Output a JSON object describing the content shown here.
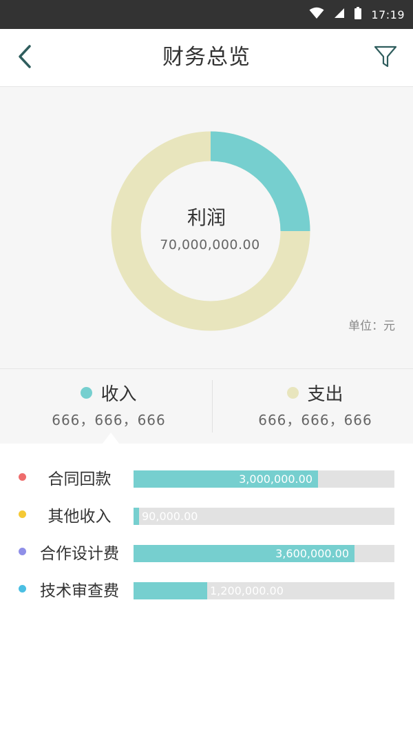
{
  "status_bar": {
    "time": "17:19",
    "icons": [
      "wifi-icon",
      "signal-icon",
      "battery-icon"
    ]
  },
  "header": {
    "title": "财务总览",
    "back_icon": "chevron-left-icon",
    "filter_icon": "filter-icon"
  },
  "donut": {
    "center_label": "利润",
    "center_value": "70,000,000.00",
    "unit": "单位：元",
    "share_income": 0.25,
    "income_color": "#76cfcf",
    "expense_color": "#e8e5bd"
  },
  "summary": {
    "income": {
      "label": "收入",
      "amount": "666，666，666",
      "color": "#76cfcf"
    },
    "expense": {
      "label": "支出",
      "amount": "666，666，666",
      "color": "#e8e5bd"
    }
  },
  "breakdown": {
    "max_value": 4250000,
    "items": [
      {
        "label": "合同回款",
        "value": 3000000,
        "value_label": "3,000,000.00",
        "bullet_color": "#ee6c6c"
      },
      {
        "label": "其他收入",
        "value": 90000,
        "value_label": "90,000.00",
        "bullet_color": "#f5c935"
      },
      {
        "label": "合作设计费",
        "value": 3600000,
        "value_label": "3,600,000.00",
        "bullet_color": "#8f8fe8"
      },
      {
        "label": "技术审查费",
        "value": 1200000,
        "value_label": "1,200,000.00",
        "bullet_color": "#4bbfe3"
      }
    ]
  }
}
